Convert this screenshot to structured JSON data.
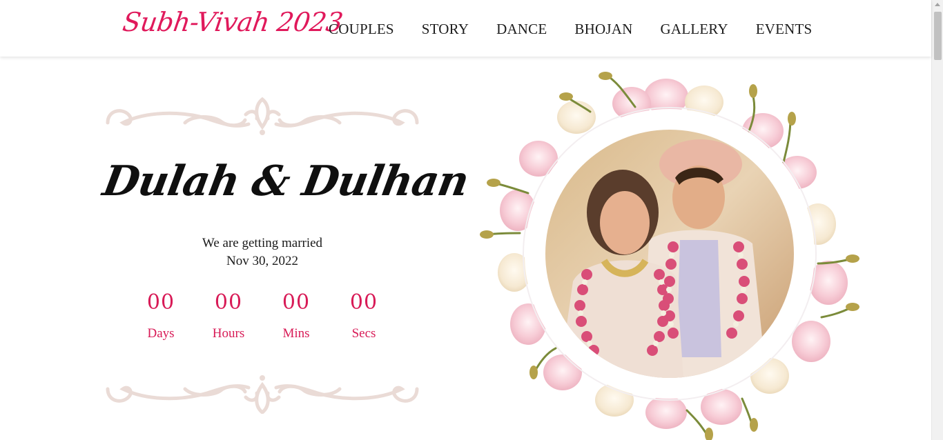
{
  "brand": {
    "title": "Subh-Vivah 2023"
  },
  "nav": {
    "items": [
      {
        "label": "COUPLES"
      },
      {
        "label": "STORY"
      },
      {
        "label": "DANCE"
      },
      {
        "label": "BHOJAN"
      },
      {
        "label": "GALLERY"
      },
      {
        "label": "EVENTS"
      }
    ]
  },
  "hero": {
    "title": "Dulah & Dulhan",
    "tagline": "We are getting married",
    "date": "Nov 30, 2022",
    "countdown": [
      {
        "value": "00",
        "label": "Days"
      },
      {
        "value": "00",
        "label": "Hours"
      },
      {
        "value": "00",
        "label": "Mins"
      },
      {
        "value": "00",
        "label": "Secs"
      }
    ]
  },
  "colors": {
    "accent": "#d81b57",
    "brand": "#e0195b",
    "nav_text": "#1c1c1c",
    "ornament": "#eadbd6",
    "petal_pink": "#f5c6cf",
    "petal_cream": "#f7ecd9"
  },
  "icons": {
    "ornament": "flourish-divider-icon",
    "scrollbar_arrow": "chevron-up-icon"
  }
}
